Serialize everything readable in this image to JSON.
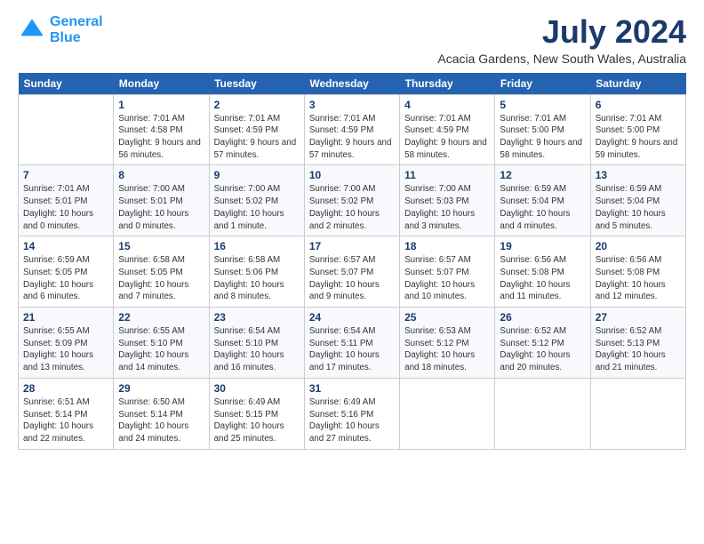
{
  "header": {
    "logo_line1": "General",
    "logo_line2": "Blue",
    "month_title": "July 2024",
    "location": "Acacia Gardens, New South Wales, Australia"
  },
  "days_of_week": [
    "Sunday",
    "Monday",
    "Tuesday",
    "Wednesday",
    "Thursday",
    "Friday",
    "Saturday"
  ],
  "weeks": [
    [
      {
        "num": "",
        "sunrise": "",
        "sunset": "",
        "daylight": ""
      },
      {
        "num": "1",
        "sunrise": "Sunrise: 7:01 AM",
        "sunset": "Sunset: 4:58 PM",
        "daylight": "Daylight: 9 hours and 56 minutes."
      },
      {
        "num": "2",
        "sunrise": "Sunrise: 7:01 AM",
        "sunset": "Sunset: 4:59 PM",
        "daylight": "Daylight: 9 hours and 57 minutes."
      },
      {
        "num": "3",
        "sunrise": "Sunrise: 7:01 AM",
        "sunset": "Sunset: 4:59 PM",
        "daylight": "Daylight: 9 hours and 57 minutes."
      },
      {
        "num": "4",
        "sunrise": "Sunrise: 7:01 AM",
        "sunset": "Sunset: 4:59 PM",
        "daylight": "Daylight: 9 hours and 58 minutes."
      },
      {
        "num": "5",
        "sunrise": "Sunrise: 7:01 AM",
        "sunset": "Sunset: 5:00 PM",
        "daylight": "Daylight: 9 hours and 58 minutes."
      },
      {
        "num": "6",
        "sunrise": "Sunrise: 7:01 AM",
        "sunset": "Sunset: 5:00 PM",
        "daylight": "Daylight: 9 hours and 59 minutes."
      }
    ],
    [
      {
        "num": "7",
        "sunrise": "Sunrise: 7:01 AM",
        "sunset": "Sunset: 5:01 PM",
        "daylight": "Daylight: 10 hours and 0 minutes."
      },
      {
        "num": "8",
        "sunrise": "Sunrise: 7:00 AM",
        "sunset": "Sunset: 5:01 PM",
        "daylight": "Daylight: 10 hours and 0 minutes."
      },
      {
        "num": "9",
        "sunrise": "Sunrise: 7:00 AM",
        "sunset": "Sunset: 5:02 PM",
        "daylight": "Daylight: 10 hours and 1 minute."
      },
      {
        "num": "10",
        "sunrise": "Sunrise: 7:00 AM",
        "sunset": "Sunset: 5:02 PM",
        "daylight": "Daylight: 10 hours and 2 minutes."
      },
      {
        "num": "11",
        "sunrise": "Sunrise: 7:00 AM",
        "sunset": "Sunset: 5:03 PM",
        "daylight": "Daylight: 10 hours and 3 minutes."
      },
      {
        "num": "12",
        "sunrise": "Sunrise: 6:59 AM",
        "sunset": "Sunset: 5:04 PM",
        "daylight": "Daylight: 10 hours and 4 minutes."
      },
      {
        "num": "13",
        "sunrise": "Sunrise: 6:59 AM",
        "sunset": "Sunset: 5:04 PM",
        "daylight": "Daylight: 10 hours and 5 minutes."
      }
    ],
    [
      {
        "num": "14",
        "sunrise": "Sunrise: 6:59 AM",
        "sunset": "Sunset: 5:05 PM",
        "daylight": "Daylight: 10 hours and 6 minutes."
      },
      {
        "num": "15",
        "sunrise": "Sunrise: 6:58 AM",
        "sunset": "Sunset: 5:05 PM",
        "daylight": "Daylight: 10 hours and 7 minutes."
      },
      {
        "num": "16",
        "sunrise": "Sunrise: 6:58 AM",
        "sunset": "Sunset: 5:06 PM",
        "daylight": "Daylight: 10 hours and 8 minutes."
      },
      {
        "num": "17",
        "sunrise": "Sunrise: 6:57 AM",
        "sunset": "Sunset: 5:07 PM",
        "daylight": "Daylight: 10 hours and 9 minutes."
      },
      {
        "num": "18",
        "sunrise": "Sunrise: 6:57 AM",
        "sunset": "Sunset: 5:07 PM",
        "daylight": "Daylight: 10 hours and 10 minutes."
      },
      {
        "num": "19",
        "sunrise": "Sunrise: 6:56 AM",
        "sunset": "Sunset: 5:08 PM",
        "daylight": "Daylight: 10 hours and 11 minutes."
      },
      {
        "num": "20",
        "sunrise": "Sunrise: 6:56 AM",
        "sunset": "Sunset: 5:08 PM",
        "daylight": "Daylight: 10 hours and 12 minutes."
      }
    ],
    [
      {
        "num": "21",
        "sunrise": "Sunrise: 6:55 AM",
        "sunset": "Sunset: 5:09 PM",
        "daylight": "Daylight: 10 hours and 13 minutes."
      },
      {
        "num": "22",
        "sunrise": "Sunrise: 6:55 AM",
        "sunset": "Sunset: 5:10 PM",
        "daylight": "Daylight: 10 hours and 14 minutes."
      },
      {
        "num": "23",
        "sunrise": "Sunrise: 6:54 AM",
        "sunset": "Sunset: 5:10 PM",
        "daylight": "Daylight: 10 hours and 16 minutes."
      },
      {
        "num": "24",
        "sunrise": "Sunrise: 6:54 AM",
        "sunset": "Sunset: 5:11 PM",
        "daylight": "Daylight: 10 hours and 17 minutes."
      },
      {
        "num": "25",
        "sunrise": "Sunrise: 6:53 AM",
        "sunset": "Sunset: 5:12 PM",
        "daylight": "Daylight: 10 hours and 18 minutes."
      },
      {
        "num": "26",
        "sunrise": "Sunrise: 6:52 AM",
        "sunset": "Sunset: 5:12 PM",
        "daylight": "Daylight: 10 hours and 20 minutes."
      },
      {
        "num": "27",
        "sunrise": "Sunrise: 6:52 AM",
        "sunset": "Sunset: 5:13 PM",
        "daylight": "Daylight: 10 hours and 21 minutes."
      }
    ],
    [
      {
        "num": "28",
        "sunrise": "Sunrise: 6:51 AM",
        "sunset": "Sunset: 5:14 PM",
        "daylight": "Daylight: 10 hours and 22 minutes."
      },
      {
        "num": "29",
        "sunrise": "Sunrise: 6:50 AM",
        "sunset": "Sunset: 5:14 PM",
        "daylight": "Daylight: 10 hours and 24 minutes."
      },
      {
        "num": "30",
        "sunrise": "Sunrise: 6:49 AM",
        "sunset": "Sunset: 5:15 PM",
        "daylight": "Daylight: 10 hours and 25 minutes."
      },
      {
        "num": "31",
        "sunrise": "Sunrise: 6:49 AM",
        "sunset": "Sunset: 5:16 PM",
        "daylight": "Daylight: 10 hours and 27 minutes."
      },
      {
        "num": "",
        "sunrise": "",
        "sunset": "",
        "daylight": ""
      },
      {
        "num": "",
        "sunrise": "",
        "sunset": "",
        "daylight": ""
      },
      {
        "num": "",
        "sunrise": "",
        "sunset": "",
        "daylight": ""
      }
    ]
  ]
}
